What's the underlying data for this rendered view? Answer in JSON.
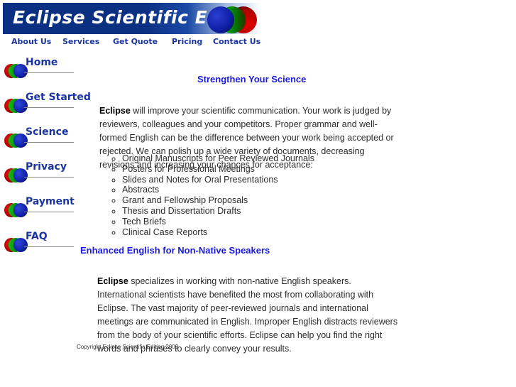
{
  "header": {
    "brand_title": "Eclipse Scientific Editing",
    "banner_color_start": "#0b3082",
    "banner_color_end": "#ffffff",
    "logo": {
      "name": "eclipse-logo",
      "circles": [
        "blue",
        "green",
        "red"
      ]
    }
  },
  "top_nav": {
    "items": [
      {
        "label": "About Us"
      },
      {
        "label": "Services"
      },
      {
        "label": "Get Quote"
      },
      {
        "label": "Pricing"
      },
      {
        "label": "Contact Us"
      }
    ]
  },
  "sidebar": {
    "items": [
      {
        "label": "Home"
      },
      {
        "label": "Get Started"
      },
      {
        "label": "Science"
      },
      {
        "label": "Privacy"
      },
      {
        "label": "Payment"
      },
      {
        "label": "FAQ"
      }
    ]
  },
  "main": {
    "title": "Strengthen Your Science",
    "intro_lead": "Eclipse",
    "intro_body": " will improve your scientific communication. Your work is judged by reviewers, colleagues and your competitors. Proper grammar and well-formed English can be the difference between your work being accepted or rejected. We can polish up a wide variety of documents, decreasing revisions and increasing your chances for acceptance:",
    "services": [
      "Original Manuscripts for Peer Reviewed Journals",
      "Posters for Professional Meetings",
      "Slides and Notes for Oral Presentations",
      "Abstracts",
      "Grant and Fellowship Proposals",
      "Thesis and Dissertation Drafts",
      "Tech Briefs",
      "Clinical Case Reports"
    ],
    "section2_title": "Enhanced English for Non-Native Speakers",
    "section2_lead": "Eclipse",
    "section2_body": " specializes in working with non-native English speakers. International scientists have benefited the most from collaborating with Eclipse. The vast majority of peer-reviewed journals and international meetings are communicated in English. Improper English distracts reviewers from the body of your scientific efforts. Eclipse can help you find the right words and phrases to clearly convey your results."
  },
  "footer": {
    "copyright": "Copyright Eclipse Scientific Editing 2009"
  },
  "colors": {
    "brand_blue": "#0b3082",
    "link_blue": "#1b35a0",
    "heading_blue": "#1a1ae0",
    "body_text": "#2b2b2b",
    "rule_gray": "#8b8b8b"
  }
}
